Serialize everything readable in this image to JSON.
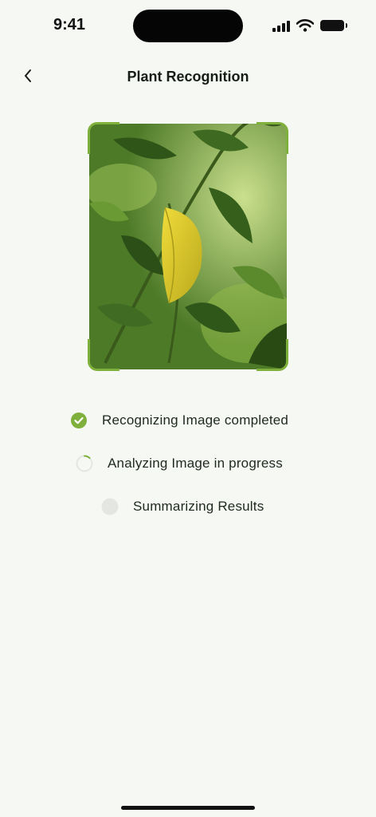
{
  "status_bar": {
    "time": "9:41"
  },
  "header": {
    "title": "Plant Recognition",
    "back_icon": "chevron-left-icon"
  },
  "scan": {
    "image_subject": "plant-photo",
    "frame_color": "#7fb03c"
  },
  "steps": [
    {
      "label": "Recognizing Image completed",
      "state": "completed",
      "icon": "check-circle-icon"
    },
    {
      "label": "Analyzing Image in progress",
      "state": "in-progress",
      "icon": "spinner-icon",
      "progress": 0.12
    },
    {
      "label": "Summarizing Results",
      "state": "pending",
      "icon": "pending-dot-icon"
    }
  ],
  "colors": {
    "accent": "#7fb03c",
    "background": "#f6f8f3",
    "pending": "#e4e6e2"
  }
}
